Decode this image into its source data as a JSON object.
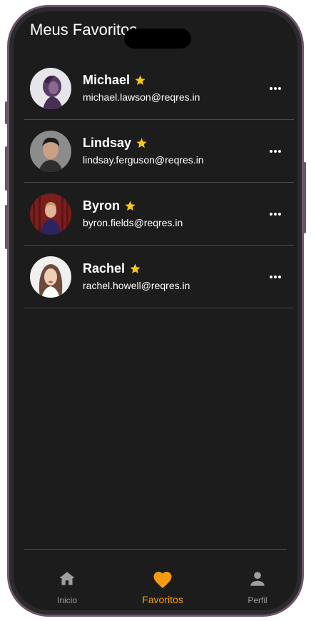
{
  "header": {
    "title": "Meus Favoritos"
  },
  "colors": {
    "background": "#1c1c1c",
    "accent": "#f39c12",
    "star": "#f5c518",
    "inactive": "#9e9e9e"
  },
  "favorites": [
    {
      "name": "Michael",
      "email": "michael.lawson@reqres.in",
      "favorite": true
    },
    {
      "name": "Lindsay",
      "email": "lindsay.ferguson@reqres.in",
      "favorite": true
    },
    {
      "name": "Byron",
      "email": "byron.fields@reqres.in",
      "favorite": true
    },
    {
      "name": "Rachel",
      "email": "rachel.howell@reqres.in",
      "favorite": true
    }
  ],
  "nav": {
    "items": [
      {
        "label": "Inicio",
        "icon": "home-icon",
        "active": false
      },
      {
        "label": "Favoritos",
        "icon": "heart-icon",
        "active": true
      },
      {
        "label": "Perfil",
        "icon": "person-icon",
        "active": false
      }
    ]
  }
}
